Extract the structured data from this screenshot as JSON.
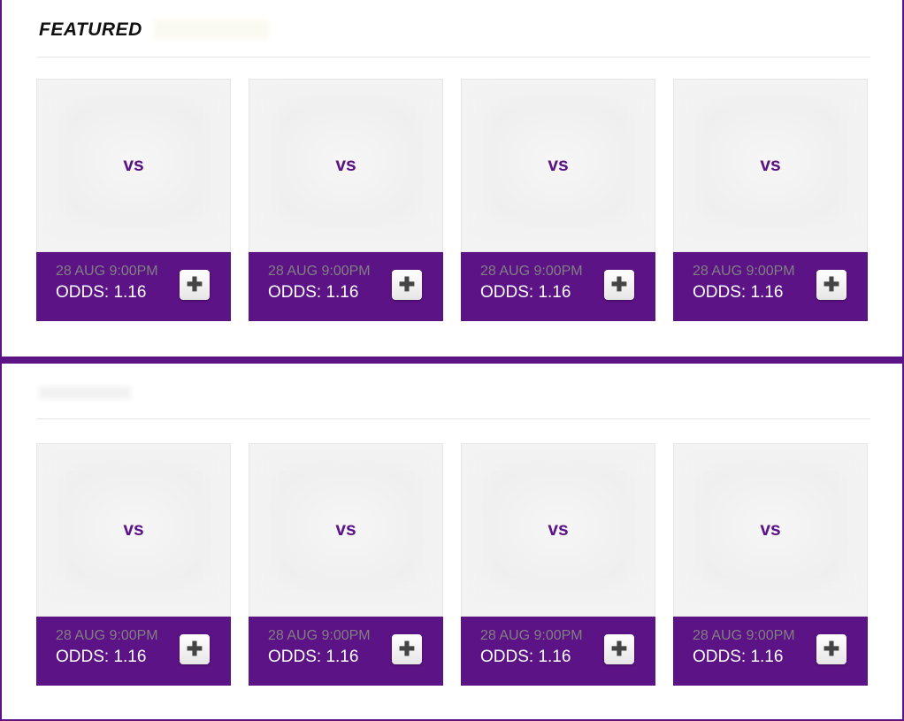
{
  "featured": {
    "title": "FEATURED",
    "matches": [
      {
        "vs": "vs",
        "date": "28 AUG 9:00PM",
        "odds": "ODDS: 1.16"
      },
      {
        "vs": "vs",
        "date": "28 AUG 9:00PM",
        "odds": "ODDS: 1.16"
      },
      {
        "vs": "vs",
        "date": "28 AUG 9:00PM",
        "odds": "ODDS: 1.16"
      },
      {
        "vs": "vs",
        "date": "28 AUG 9:00PM",
        "odds": "ODDS: 1.16"
      }
    ]
  },
  "second": {
    "matches": [
      {
        "vs": "vs",
        "date": "28 AUG 9:00PM",
        "odds": "ODDS: 1.16"
      },
      {
        "vs": "vs",
        "date": "28 AUG 9:00PM",
        "odds": "ODDS: 1.16"
      },
      {
        "vs": "vs",
        "date": "28 AUG 9:00PM",
        "odds": "ODDS: 1.16"
      },
      {
        "vs": "vs",
        "date": "28 AUG 9:00PM",
        "odds": "ODDS: 1.16"
      }
    ]
  },
  "icons": {
    "add": "plus-icon"
  },
  "colors": {
    "accent": "#5c1386",
    "date_text": "#808080"
  }
}
